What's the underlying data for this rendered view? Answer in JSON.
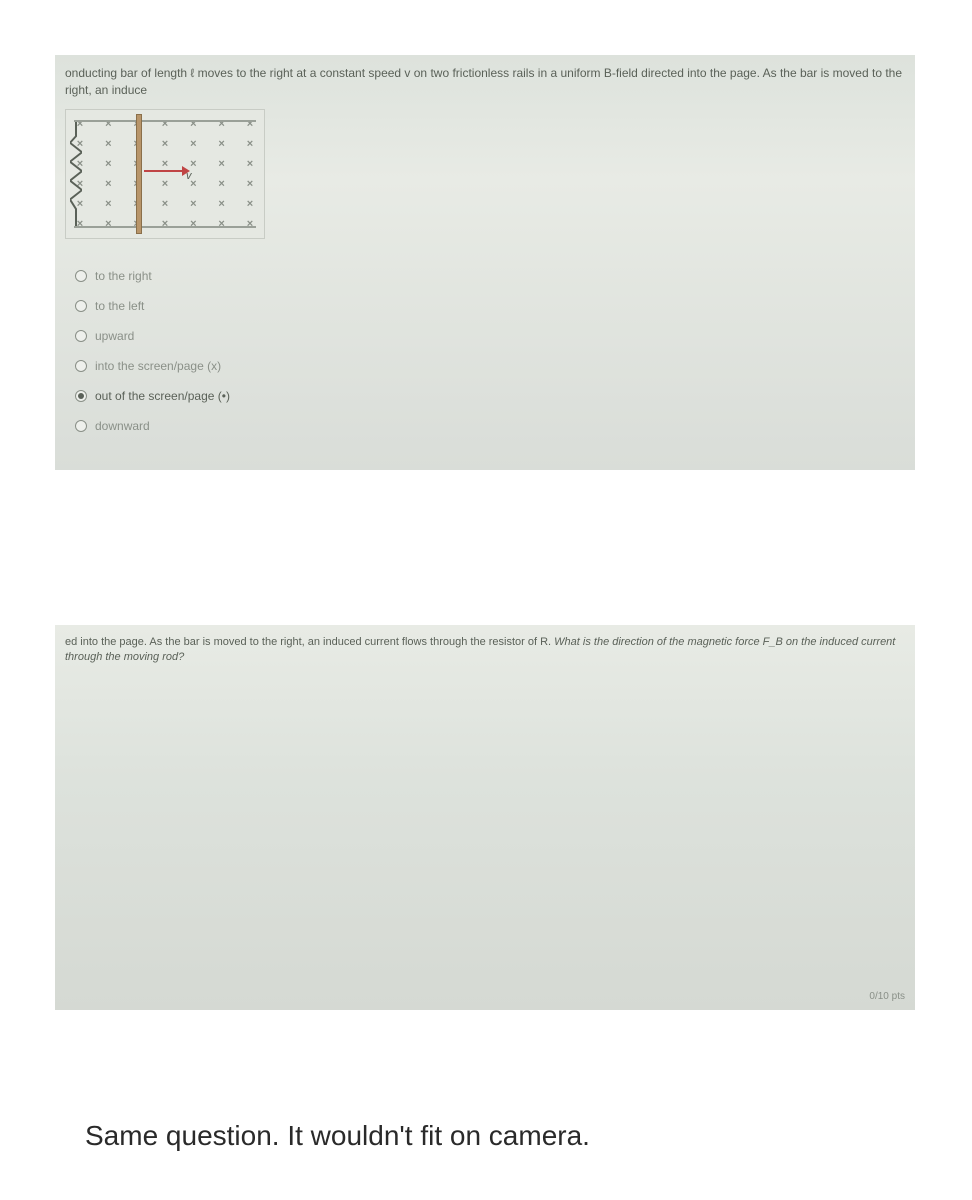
{
  "question1": {
    "text": "onducting bar of length ℓ moves to the right at a constant speed v on two frictionless rails in a uniform B-field directed into the page. As the bar is moved to the right, an induce",
    "v_label": "v",
    "options": [
      {
        "label": "to the right",
        "selected": false
      },
      {
        "label": "to the left",
        "selected": false
      },
      {
        "label": "upward",
        "selected": false
      },
      {
        "label": "into the screen/page (x)",
        "selected": false
      },
      {
        "label": "out of the screen/page (•)",
        "selected": true
      },
      {
        "label": "downward",
        "selected": false
      }
    ]
  },
  "question2": {
    "text_part1": "ed into the page. As the bar is moved to the right, an induced current flows through the resistor of R. ",
    "text_italic": "What is the direction of the magnetic force F_B on the induced current through the moving rod?",
    "points": "0/10 pts"
  },
  "caption": "Same question. It wouldn't fit on camera."
}
